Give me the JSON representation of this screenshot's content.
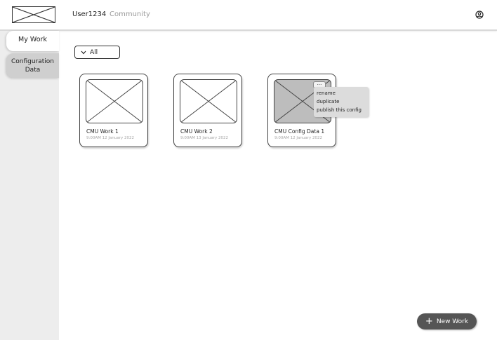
{
  "header": {
    "user_label": "User1234",
    "community_label": "Community",
    "logo_icon": "image-placeholder-icon",
    "account_icon": "account-circle-icon"
  },
  "sidebar": {
    "items": [
      {
        "label": "My Work",
        "active": true
      },
      {
        "label": "Configuration Data",
        "active": false
      }
    ]
  },
  "filter": {
    "selected": "All",
    "icon": "chevron-down-icon"
  },
  "cards": [
    {
      "title": "CMU Work 1",
      "date": "9:00AM 12 January 2022"
    },
    {
      "title": "CMU Work 2",
      "date": "9:00AM 13 January 2022"
    },
    {
      "title": "CMU Config Data 1",
      "date": "9:00AM 12 January 2022"
    }
  ],
  "context_menu": {
    "trigger_label": "...",
    "items": [
      "rename",
      "duplicate",
      "publish this config"
    ]
  },
  "fab": {
    "icon": "+",
    "label": "New Work"
  },
  "colors": {
    "sidebar_bg": "#ededed",
    "inactive_tab": "#cfcfcf",
    "selected_thumb": "#bdbdbd",
    "menu_bg": "#dcdcdc",
    "fab_bg": "#555555"
  }
}
